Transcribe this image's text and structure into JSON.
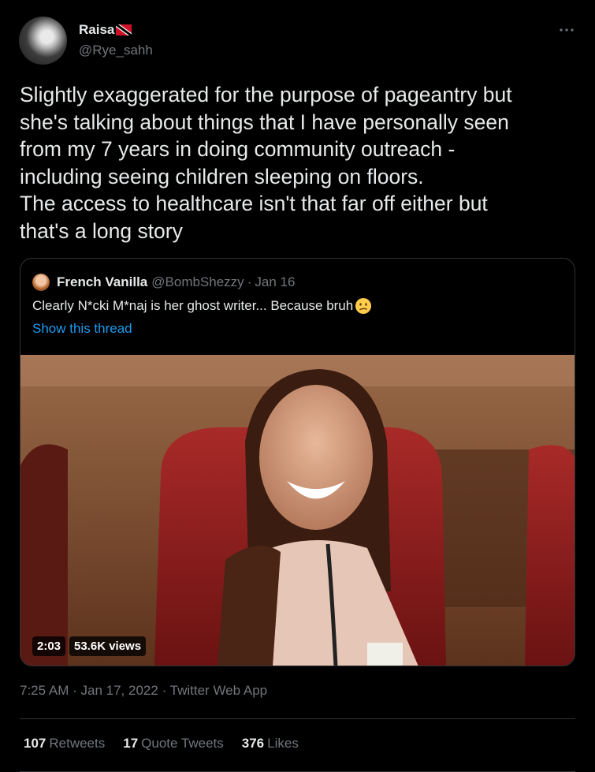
{
  "author": {
    "display_name": "Raisa",
    "handle": "@Rye_sahh",
    "flag_icon": "trinidad-and-tobago-flag"
  },
  "tweet": {
    "text_lines": [
      "Slightly exaggerated for the purpose of pageantry but",
      "she's talking about things that I have personally seen",
      "from my 7 years in doing community outreach -",
      "including seeing children sleeping on floors.",
      "The access to healthcare isn't that far off either but",
      "that's a long story"
    ]
  },
  "quote": {
    "name": "French Vanilla",
    "handle": "@BombShezzy",
    "separator": "·",
    "date": "Jan 16",
    "text": "Clearly N*cki M*naj is her ghost writer... Because bruh",
    "emoji_icon": "confused-face",
    "show_thread": "Show this thread",
    "video": {
      "duration": "2:03",
      "views": "53.6K views"
    }
  },
  "meta": {
    "time": "7:25 AM",
    "separator": "·",
    "date": "Jan 17, 2022",
    "source": "Twitter Web App"
  },
  "stats": {
    "retweets_count": "107",
    "retweets_label": "Retweets",
    "quotes_count": "17",
    "quotes_label": "Quote Tweets",
    "likes_count": "376",
    "likes_label": "Likes"
  },
  "colors": {
    "background": "#000000",
    "text": "#e7e9ea",
    "secondary": "#71767b",
    "link": "#1d9bf0",
    "border": "#2f3336"
  }
}
